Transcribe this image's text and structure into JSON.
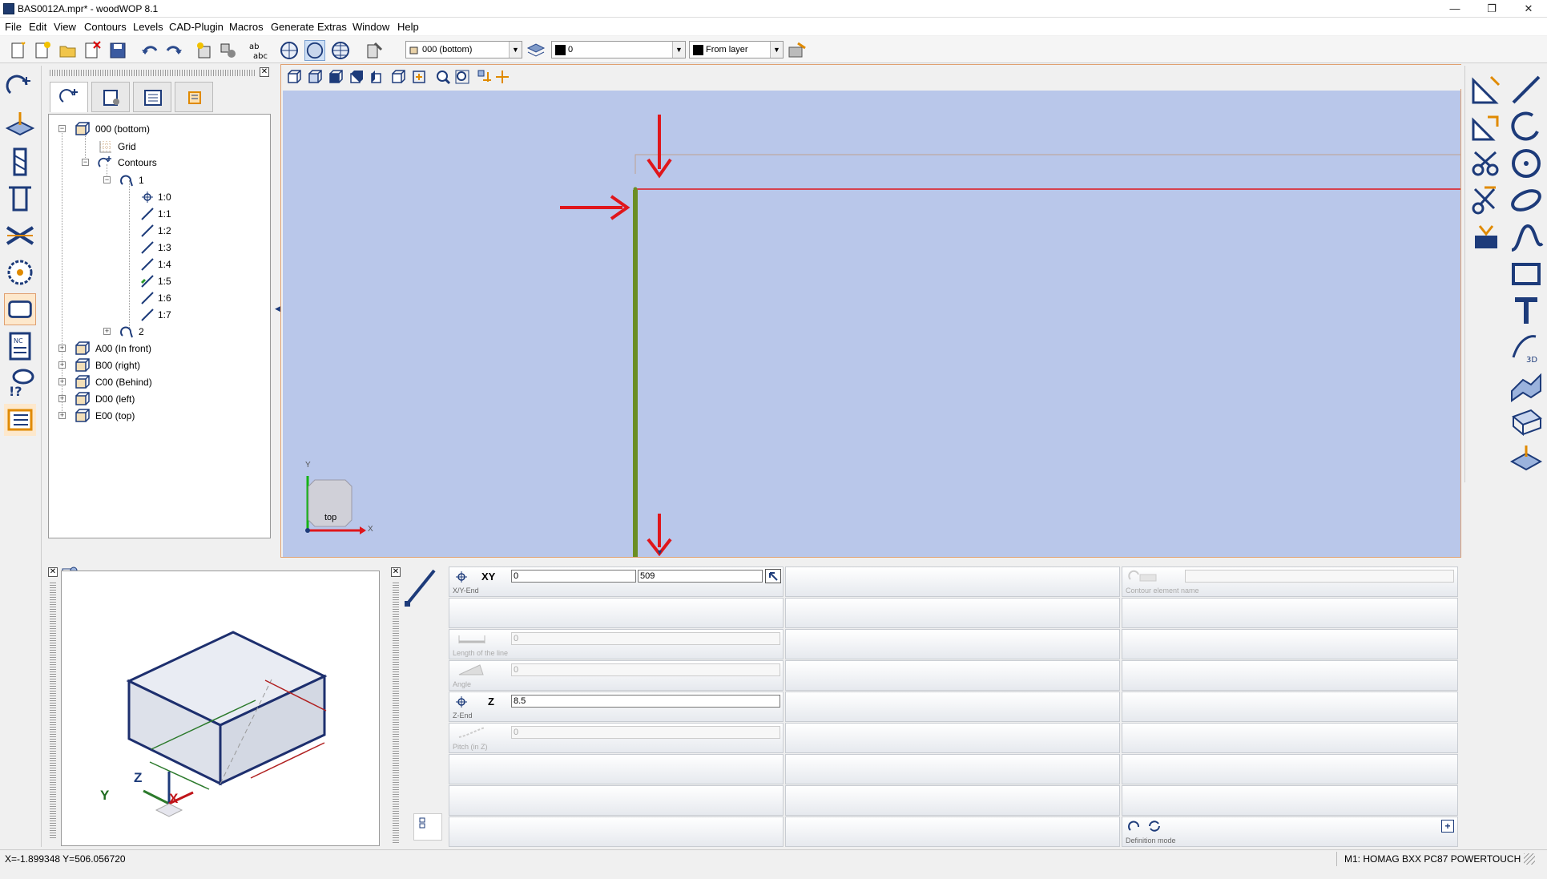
{
  "window": {
    "title": "BAS0012A.mpr* - woodWOP 8.1",
    "minimize": "—",
    "maximize": "❐",
    "close": "✕"
  },
  "menu": [
    "File",
    "Edit",
    "View",
    "Contours",
    "Levels",
    "CAD-Plugin",
    "Macros",
    "Generate",
    "Extras",
    "Window",
    "Help"
  ],
  "toolbar": {
    "level_combo": "000  (bottom)",
    "layer_combo": "0",
    "color_combo": "From layer"
  },
  "tree": {
    "items": [
      {
        "label": "000 (bottom)"
      },
      {
        "label": "Grid"
      },
      {
        "label": "Contours"
      },
      {
        "label": "1"
      },
      {
        "label": "1:0"
      },
      {
        "label": "1:1"
      },
      {
        "label": "1:2"
      },
      {
        "label": "1:3"
      },
      {
        "label": "1:4"
      },
      {
        "label": "1:5"
      },
      {
        "label": "1:6"
      },
      {
        "label": "1:7"
      },
      {
        "label": "2"
      },
      {
        "label": "A00 (In front)"
      },
      {
        "label": "B00 (right)"
      },
      {
        "label": "C00 (Behind)"
      },
      {
        "label": "D00 (left)"
      },
      {
        "label": "E00 (top)"
      }
    ]
  },
  "viewport": {
    "cube_label": "top",
    "axis_y": "Y",
    "axis_x": "X",
    "canvas_color": "#b9c7ea",
    "contour_color": "#6b8e23"
  },
  "iso": {
    "axis_z": "Z",
    "axis_y": "Y",
    "axis_x": "X"
  },
  "props": {
    "xy_label": "XY",
    "xy_caption": "X/Y-End",
    "x_value": "0",
    "y_value": "509",
    "length_caption": "Length of the line",
    "length_value": "0",
    "angle_caption": "Angle",
    "angle_value": "0",
    "z_label": "Z",
    "z_caption": "Z-End",
    "z_value": "8.5",
    "pitch_caption": "Pitch (in Z)",
    "pitch_value": "0",
    "contour_name_caption": "Contour element name",
    "definition_mode": "Definition mode",
    "plus": "+"
  },
  "status": {
    "coords": "X=-1.899348 Y=506.056720",
    "machine": "M1: HOMAG BXX PC87 POWERTOUCH"
  }
}
